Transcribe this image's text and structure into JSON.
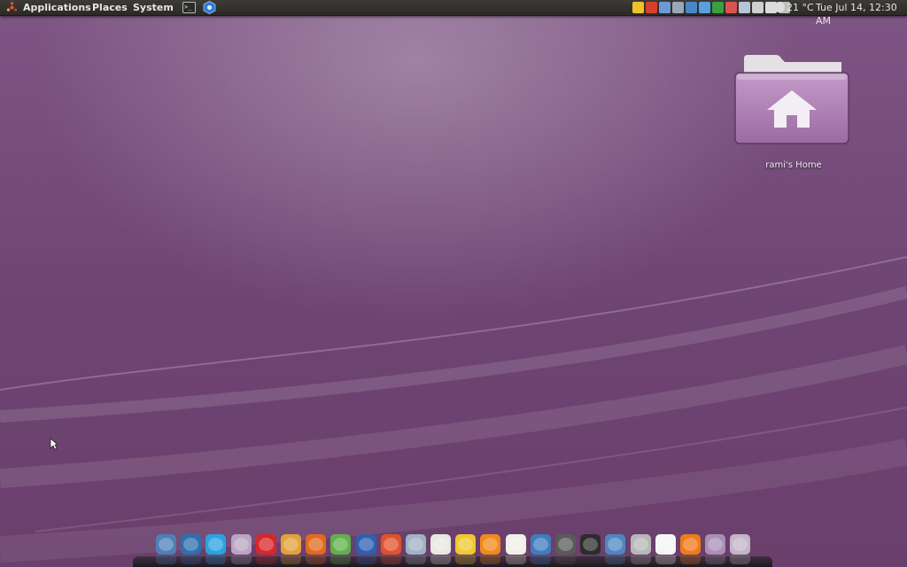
{
  "panel": {
    "menus": [
      "Applications",
      "Places",
      "System"
    ],
    "launchers": [
      {
        "icon": "terminal-icon",
        "glyph": ">_"
      },
      {
        "icon": "app-launcher-icon"
      }
    ],
    "tray_icons": [
      {
        "icon": "notes-icon",
        "color": "#f0c22a"
      },
      {
        "icon": "pidgin-icon",
        "color": "#d8402e"
      },
      {
        "icon": "update-icon",
        "color": "#6a9bd8"
      },
      {
        "icon": "network-icon",
        "color": "#9aa7b8"
      },
      {
        "icon": "bluetooth-icon",
        "color": "#4a86c8"
      },
      {
        "icon": "dropbox-icon",
        "color": "#5aa0e0"
      },
      {
        "icon": "chrome-icon",
        "color": "#3aa040"
      },
      {
        "icon": "download-icon",
        "color": "#d9534f"
      },
      {
        "icon": "photos-icon",
        "color": "#b8c4d8"
      },
      {
        "icon": "printer-icon",
        "color": "#cfcfcf"
      },
      {
        "icon": "mail-icon",
        "color": "#dcdcdc"
      },
      {
        "icon": "volume-icon",
        "color": "#bdbdbd"
      }
    ],
    "temperature": "21 °C",
    "clock": "Tue Jul 14, 12:30 AM"
  },
  "desktop": {
    "home_label": "rami's Home"
  },
  "dock": {
    "items": [
      {
        "icon": "installer-icon",
        "color": "#4d7fb8"
      },
      {
        "icon": "browser-globe-icon",
        "color": "#2f6fae"
      },
      {
        "icon": "skype-icon",
        "color": "#2aa3e0"
      },
      {
        "icon": "chat-icon",
        "color": "#b9a5c2"
      },
      {
        "icon": "opera-icon",
        "color": "#d8262a"
      },
      {
        "icon": "contacts-icon",
        "color": "#e2a23a"
      },
      {
        "icon": "firefox-icon",
        "color": "#e26a1c"
      },
      {
        "icon": "people-icon",
        "color": "#62b04a"
      },
      {
        "icon": "google-earth-icon",
        "color": "#2f5fb0"
      },
      {
        "icon": "close-x-icon",
        "color": "#e0522c"
      },
      {
        "icon": "globe-icon",
        "color": "#9fb2c4"
      },
      {
        "icon": "calculator-icon",
        "color": "#e8e8e0"
      },
      {
        "icon": "note-folder-icon",
        "color": "#f0c830"
      },
      {
        "icon": "vlc-icon",
        "color": "#f08a1a"
      },
      {
        "icon": "text-editor-icon",
        "color": "#f1efe6"
      },
      {
        "icon": "thunderbird-icon",
        "color": "#3f7cbf"
      },
      {
        "icon": "movie-icon",
        "color": "#5a5a5a"
      },
      {
        "icon": "terminal-icon",
        "color": "#2c2c2c"
      },
      {
        "icon": "network-globe-icon",
        "color": "#4f86c1"
      },
      {
        "icon": "weather-icon",
        "color": "#b7b7b7"
      },
      {
        "icon": "notification-icon",
        "color": "#f5f5f5"
      },
      {
        "icon": "rss-icon",
        "color": "#f07a1a"
      },
      {
        "icon": "monitor-icon",
        "color": "#a98fb4"
      },
      {
        "icon": "folder-icon",
        "color": "#c4b5c9"
      }
    ]
  }
}
